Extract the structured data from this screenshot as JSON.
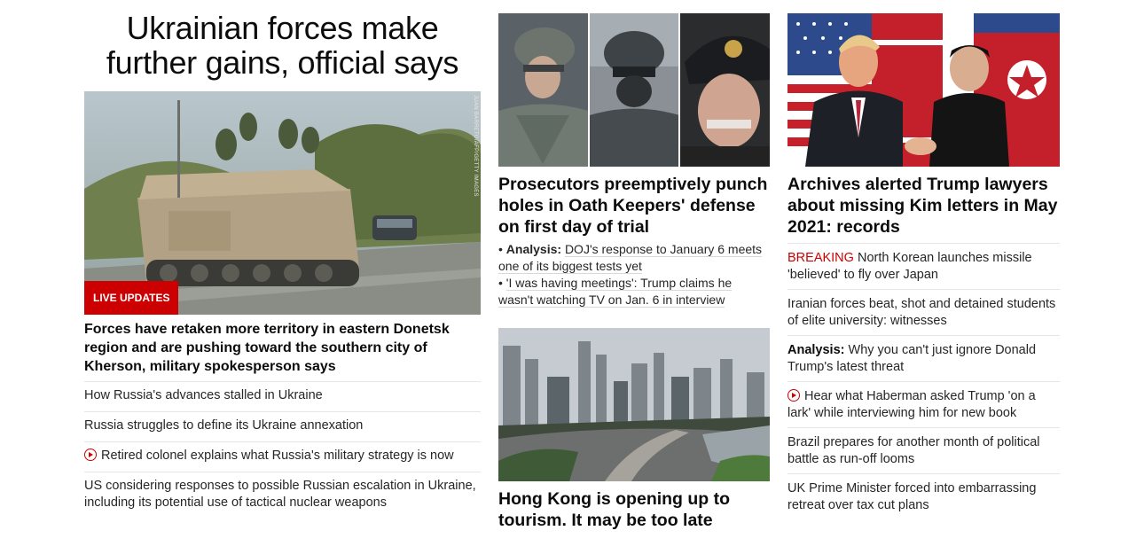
{
  "col1": {
    "headline": "Ukrainian forces make further gains, official says",
    "badge": "LIVE UPDATES",
    "photo_credit": "JUAN BARRETO/AFP/GETTY IMAGES",
    "description": "Forces have retaken more territory in eastern Donetsk region and are pushing toward the southern city of Kherson, military spokesperson says",
    "links": [
      "How Russia's advances stalled in Ukraine",
      "Russia struggles to define its Ukraine annexation",
      "Retired colonel explains what Russia's military strategy is now",
      "US considering responses to possible Russian escalation in Ukraine, including its potential use of tactical nuclear weapons"
    ]
  },
  "col2": {
    "headline": "Prosecutors preemptively punch holes in Oath Keepers' defense on first day of trial",
    "sublinks": [
      {
        "prefix": "Analysis:",
        "text": "DOJ's response to January 6 meets one of its biggest tests yet"
      },
      {
        "prefix": "",
        "text": "'I was having meetings': Trump claims he wasn't watching TV on Jan. 6 in interview"
      }
    ],
    "headline2": "Hong Kong is opening up to tourism. It may be too late"
  },
  "col3": {
    "headline": "Archives alerted Trump lawyers about missing Kim letters in May 2021: records",
    "links": [
      {
        "tag": "BREAKING",
        "text": "North Korean launches missile 'believed' to fly over Japan"
      },
      {
        "tag": "",
        "text": "Iranian forces beat, shot and detained students of elite university: witnesses"
      },
      {
        "tag": "Analysis:",
        "text": "Why you can't just ignore Donald Trump's latest threat"
      },
      {
        "tag": "",
        "text": "Hear what Haberman asked Trump 'on a lark' while interviewing him for new book"
      },
      {
        "tag": "",
        "text": "Brazil prepares for another month of political battle as run-off looms"
      },
      {
        "tag": "",
        "text": "UK Prime Minister forced into embarrassing retreat over tax cut plans"
      }
    ]
  },
  "colors": {
    "accent": "#cc0000",
    "text": "#0c0c0c",
    "divider": "#e6e6e6"
  }
}
